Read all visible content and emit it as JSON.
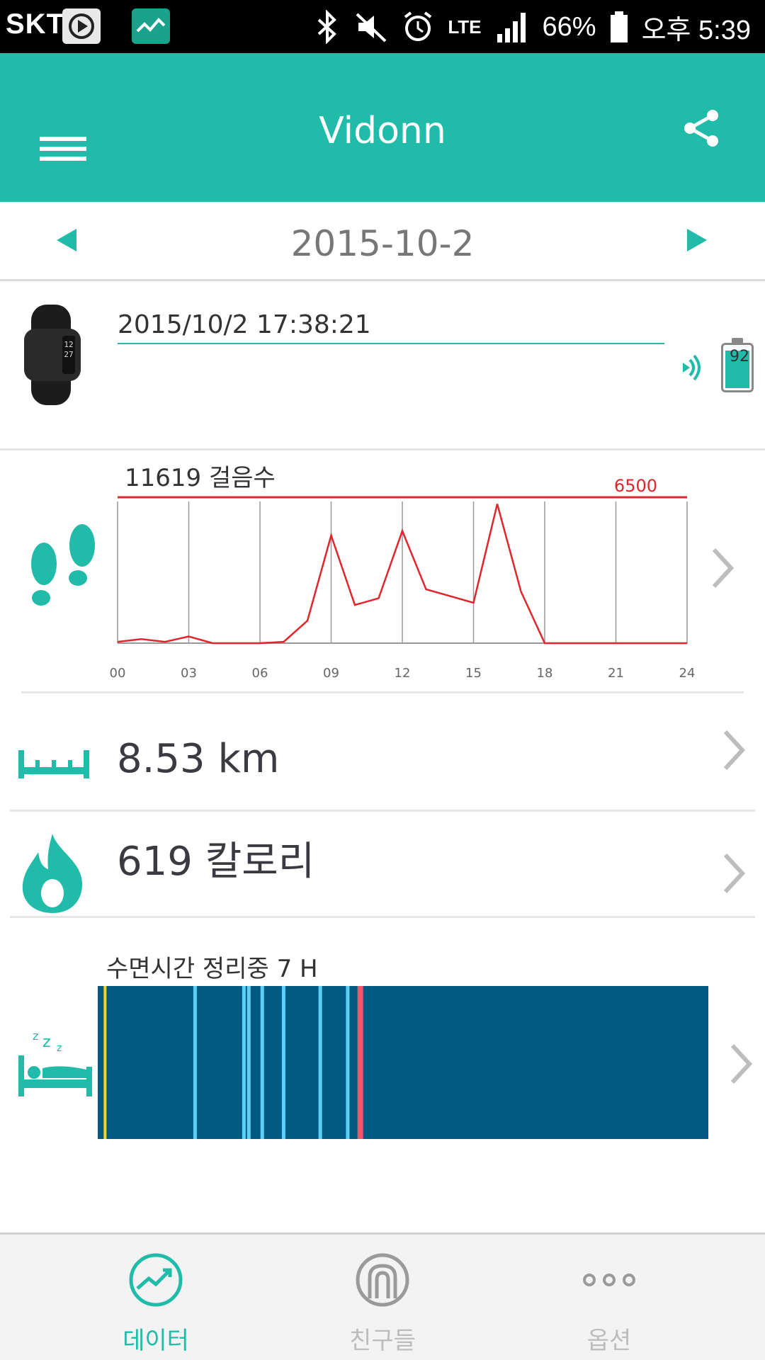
{
  "status_bar": {
    "carrier": "SKT",
    "network": "LTE",
    "battery": "66%",
    "time": "오후 5:39"
  },
  "app_bar": {
    "title": "Vidonn"
  },
  "date_nav": {
    "date": "2015-10-2"
  },
  "device": {
    "sync_time": "2015/10/2 17:38:21",
    "battery_level": "92",
    "battery_fraction": 0.92
  },
  "steps": {
    "label": "11619 걸음수",
    "goal": "6500"
  },
  "distance": {
    "value": "8.53  km"
  },
  "calories": {
    "value": "619  칼로리"
  },
  "sleep": {
    "label": "수면시간 정리중 7 H"
  },
  "bottom_nav": {
    "items": [
      {
        "label": "데이터",
        "icon": "chart-icon",
        "active": true
      },
      {
        "label": "친구들",
        "icon": "friends-icon",
        "active": false
      },
      {
        "label": "옵션",
        "icon": "more-icon",
        "active": false
      }
    ]
  },
  "colors": {
    "primary": "#21bca9",
    "chart_line": "#e0262c",
    "sleep_deep": "#025a83",
    "sleep_light": "#5fd0f5",
    "sleep_awake": "#ef5a6a",
    "sleep_start": "#f5d31e"
  },
  "chart_data": {
    "type": "line",
    "title": "11619 걸음수",
    "x_ticks": [
      "00",
      "03",
      "06",
      "09",
      "12",
      "15",
      "18",
      "21",
      "24"
    ],
    "xlim": [
      0,
      24
    ],
    "goal_value": 6500,
    "ylim": [
      0,
      6500
    ],
    "x": [
      0,
      1,
      2,
      3,
      4,
      5,
      6,
      7,
      8,
      9,
      10,
      11,
      12,
      13,
      14,
      15,
      16,
      17,
      18,
      19,
      20,
      21,
      22,
      23,
      24
    ],
    "series": [
      {
        "values": [
          60,
          180,
          60,
          300,
          0,
          0,
          0,
          60,
          1000,
          4800,
          1700,
          2000,
          5000,
          2400,
          2100,
          1800,
          6200,
          2300,
          0,
          0,
          0,
          0,
          0,
          0,
          0
        ]
      }
    ],
    "grid": true
  },
  "sleep_data": {
    "start_marker": 0.012,
    "light_marks": [
      0.16,
      0.24,
      0.248,
      0.27,
      0.305,
      0.365,
      0.41
    ],
    "awake_mark": 0.43
  }
}
